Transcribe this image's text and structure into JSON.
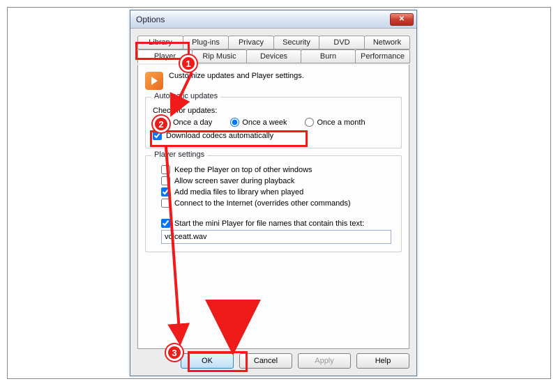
{
  "window": {
    "title": "Options"
  },
  "tabs": {
    "row1": [
      "Library",
      "Plug-ins",
      "Privacy",
      "Security",
      "DVD",
      "Network"
    ],
    "row2": [
      "Player",
      "Rip Music",
      "Devices",
      "Burn",
      "Performance"
    ],
    "active": "Player"
  },
  "intro_text": "Customize updates and Player settings.",
  "updates": {
    "legend": "Automatic updates",
    "check_label": "Check for updates:",
    "options": {
      "day": "Once a day",
      "week": "Once a week",
      "month": "Once a month"
    },
    "selected": "week",
    "download_codecs_label": "Download codecs automatically",
    "download_codecs_checked": true
  },
  "player_settings": {
    "legend": "Player settings",
    "keep_on_top": {
      "label": "Keep the Player on top of other windows",
      "checked": false
    },
    "screensaver": {
      "label": "Allow screen saver during playback",
      "checked": false
    },
    "add_to_library": {
      "label": "Add media files to library when played",
      "checked": true
    },
    "internet": {
      "label": "Connect to the Internet (overrides other commands)",
      "checked": false
    },
    "mini_player": {
      "label": "Start the mini Player for file names that contain this text:",
      "checked": true
    },
    "mini_player_value": "voiceatt.wav"
  },
  "buttons": {
    "ok": "OK",
    "cancel": "Cancel",
    "apply": "Apply",
    "help": "Help"
  },
  "annotations": {
    "m1": "1",
    "m2": "2",
    "m3": "3"
  }
}
